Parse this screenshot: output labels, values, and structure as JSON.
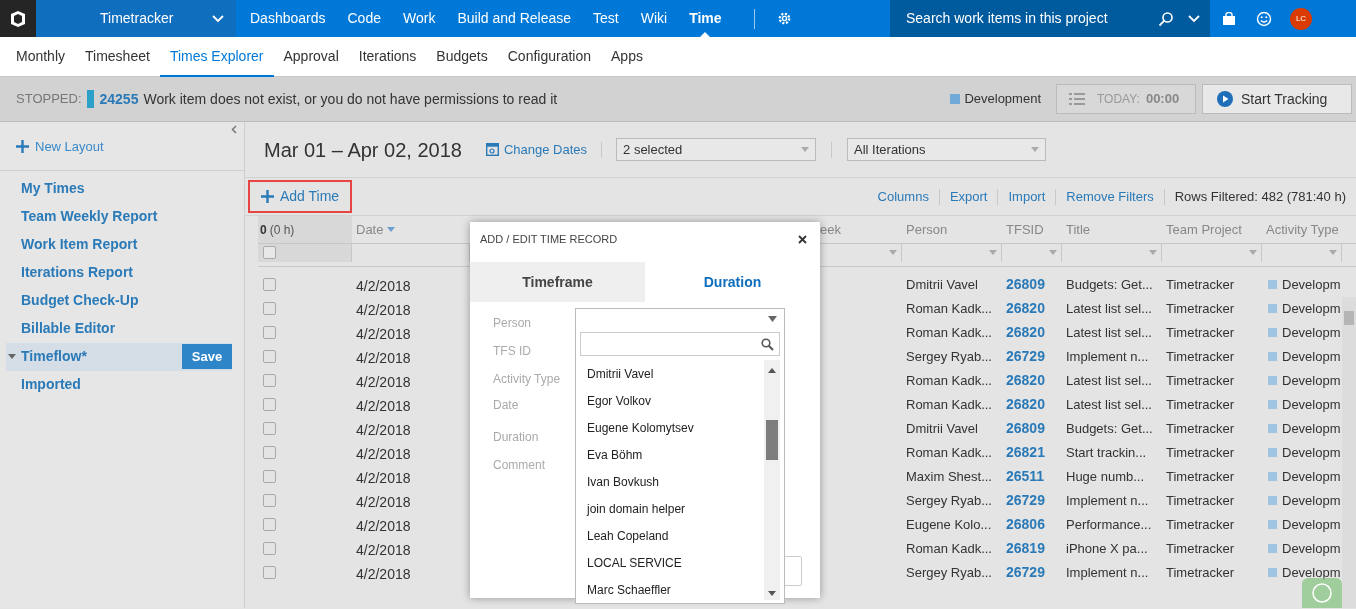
{
  "top_nav": {
    "project": "Timetracker",
    "items": [
      {
        "label": "Dashboards",
        "selected": false
      },
      {
        "label": "Code",
        "selected": false
      },
      {
        "label": "Work",
        "selected": false
      },
      {
        "label": "Build and Release",
        "selected": false
      },
      {
        "label": "Test",
        "selected": false
      },
      {
        "label": "Wiki",
        "selected": false
      },
      {
        "label": "Time",
        "selected": true
      }
    ],
    "search_placeholder": "Search work items in this project",
    "avatar": "LC"
  },
  "hub_tabs": [
    {
      "label": "Monthly",
      "selected": false
    },
    {
      "label": "Timesheet",
      "selected": false
    },
    {
      "label": "Times Explorer",
      "selected": true
    },
    {
      "label": "Approval",
      "selected": false
    },
    {
      "label": "Iterations",
      "selected": false
    },
    {
      "label": "Budgets",
      "selected": false
    },
    {
      "label": "Configuration",
      "selected": false
    },
    {
      "label": "Apps",
      "selected": false
    }
  ],
  "status_bar": {
    "state": "STOPPED:",
    "work_item_id": "24255",
    "message": "Work item does not exist, or you do not have permissions to read it",
    "activity": "Development",
    "today_label": "TODAY:",
    "today_value": "00:00",
    "start_button": "Start Tracking"
  },
  "sidebar": {
    "new_layout": "New Layout",
    "save_button": "Save",
    "layouts": [
      {
        "label": "My Times",
        "selected": false
      },
      {
        "label": "Team Weekly Report",
        "selected": false
      },
      {
        "label": "Work Item Report",
        "selected": false
      },
      {
        "label": "Iterations Report",
        "selected": false
      },
      {
        "label": "Budget Check-Up",
        "selected": false
      },
      {
        "label": "Billable Editor",
        "selected": false
      },
      {
        "label": "Timeflow*",
        "selected": true
      },
      {
        "label": "Imported",
        "selected": false
      }
    ]
  },
  "toolbar": {
    "date_range": "Mar 01 – Apr 02, 2018",
    "change_dates": "Change Dates",
    "person_filter": "2 selected",
    "iteration_filter": "All Iterations"
  },
  "actions": {
    "add_time": "Add Time",
    "links": [
      "Columns",
      "Export",
      "Import",
      "Remove Filters"
    ],
    "rows_filtered": "Rows Filtered: 482 (781:40 h)"
  },
  "table": {
    "select_all_checked": false,
    "summary_count": "0",
    "summary_hours": "(0 h)",
    "columns": [
      "Date",
      "eek",
      "Person",
      "TFSID",
      "Title",
      "Team Project",
      "Activity Type"
    ],
    "rows": [
      {
        "checked": false,
        "date": "4/2/2018",
        "person": "Dmitrii Vavel",
        "tfsid": "26809",
        "title": "Budgets: Get...",
        "project": "Timetracker",
        "activity": "Developm"
      },
      {
        "checked": false,
        "date": "4/2/2018",
        "person": "Roman Kadk...",
        "tfsid": "26820",
        "title": "Latest list sel...",
        "project": "Timetracker",
        "activity": "Developm"
      },
      {
        "checked": false,
        "date": "4/2/2018",
        "person": "Roman Kadk...",
        "tfsid": "26820",
        "title": "Latest list sel...",
        "project": "Timetracker",
        "activity": "Developm"
      },
      {
        "checked": false,
        "date": "4/2/2018",
        "person": "Sergey Ryab...",
        "tfsid": "26729",
        "title": "Implement n...",
        "project": "Timetracker",
        "activity": "Developm"
      },
      {
        "checked": false,
        "date": "4/2/2018",
        "person": "Roman Kadk...",
        "tfsid": "26820",
        "title": "Latest list sel...",
        "project": "Timetracker",
        "activity": "Developm"
      },
      {
        "checked": false,
        "date": "4/2/2018",
        "person": "Roman Kadk...",
        "tfsid": "26820",
        "title": "Latest list sel...",
        "project": "Timetracker",
        "activity": "Developm"
      },
      {
        "checked": false,
        "date": "4/2/2018",
        "person": "Dmitrii Vavel",
        "tfsid": "26809",
        "title": "Budgets: Get...",
        "project": "Timetracker",
        "activity": "Developm"
      },
      {
        "checked": false,
        "date": "4/2/2018",
        "person": "Roman Kadk...",
        "tfsid": "26821",
        "title": "Start trackin...",
        "project": "Timetracker",
        "activity": "Developm"
      },
      {
        "checked": false,
        "date": "4/2/2018",
        "person": "Maxim Shest...",
        "tfsid": "26511",
        "title": "Huge numb...",
        "project": "Timetracker",
        "activity": "Developm"
      },
      {
        "checked": false,
        "date": "4/2/2018",
        "person": "Sergey Ryab...",
        "tfsid": "26729",
        "title": "Implement n...",
        "project": "Timetracker",
        "activity": "Developm"
      },
      {
        "checked": false,
        "date": "4/2/2018",
        "person": "Eugene Kolo...",
        "tfsid": "26806",
        "title": "Performance...",
        "project": "Timetracker",
        "activity": "Developm"
      },
      {
        "checked": false,
        "date": "4/2/2018",
        "person": "Roman Kadk...",
        "tfsid": "26819",
        "title": "iPhone X pa...",
        "project": "Timetracker",
        "activity": "Developm"
      },
      {
        "checked": false,
        "date": "4/2/2018",
        "person": "Sergey Ryab...",
        "tfsid": "26729",
        "title": "Implement n...",
        "project": "Timetracker",
        "activity": "Developm"
      }
    ]
  },
  "dialog": {
    "title": "ADD / EDIT TIME RECORD",
    "tabs": [
      {
        "label": "Timeframe",
        "selected": false
      },
      {
        "label": "Duration",
        "selected": true
      }
    ],
    "fields": [
      "Person",
      "TFS ID",
      "Activity Type",
      "Date",
      "Duration",
      "Comment"
    ],
    "person_options": [
      "Dmitrii Vavel",
      "Egor Volkov",
      "Eugene Kolomytsev",
      "Eva Böhm",
      "Ivan Bovkush",
      "join domain helper",
      "Leah Copeland",
      "LOCAL SERVICE",
      "Marc Schaeffler"
    ]
  }
}
